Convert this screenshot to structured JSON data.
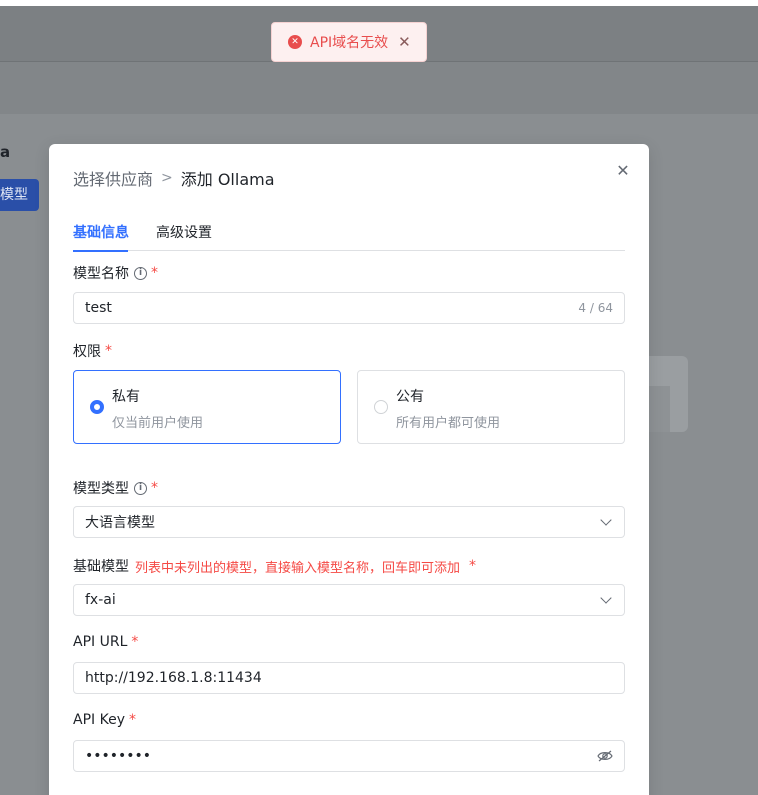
{
  "toast": {
    "message": "API域名无效",
    "icon": "error-circle-icon",
    "color": "#e84d4d"
  },
  "background": {
    "title_fragment": "a",
    "button_fragment": "模型"
  },
  "dialog": {
    "breadcrumb": {
      "previous": "选择供应商",
      "separator": ">",
      "current": "添加 Ollama"
    },
    "tabs": [
      {
        "label": "基础信息",
        "active": true
      },
      {
        "label": "高级设置",
        "active": false
      }
    ],
    "model_name": {
      "label": "模型名称",
      "required_mark": "*",
      "value": "test",
      "counter": "4 / 64"
    },
    "permission": {
      "label": "权限",
      "required_mark": "*",
      "options": [
        {
          "title": "私有",
          "description": "仅当前用户使用",
          "selected": true
        },
        {
          "title": "公有",
          "description": "所有用户都可使用",
          "selected": false
        }
      ]
    },
    "model_type": {
      "label": "模型类型",
      "required_mark": "*",
      "value": "大语言模型"
    },
    "base_model": {
      "label": "基础模型",
      "hint": "列表中未列出的模型，直接输入模型名称，回车即可添加",
      "required_mark": "*",
      "value": "fx-ai"
    },
    "api_url": {
      "label": "API URL",
      "required_mark": "*",
      "value": "http://192.168.1.8:11434"
    },
    "api_key": {
      "label": "API Key",
      "required_mark": "*",
      "value": "••••••••"
    }
  },
  "colors": {
    "primary": "#3370ff",
    "error": "#f54a45",
    "border": "#dee0e3"
  }
}
